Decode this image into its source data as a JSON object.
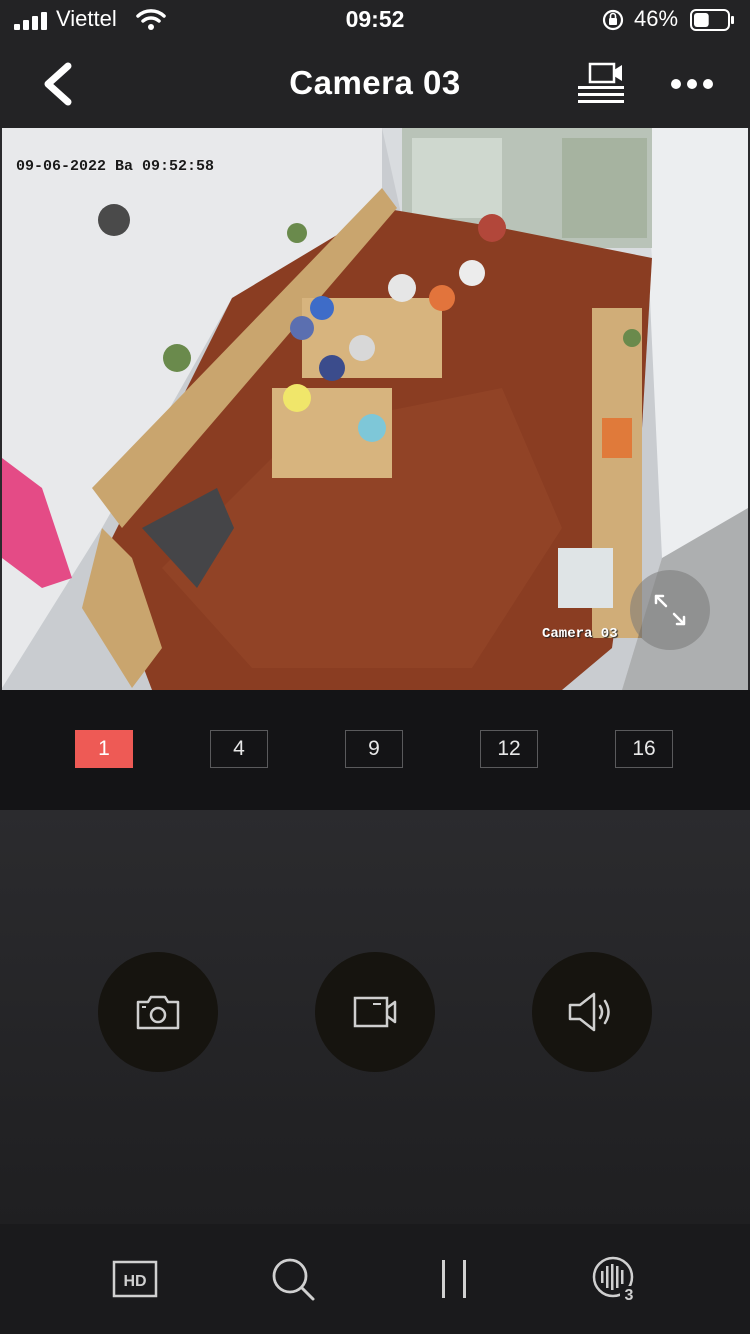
{
  "status_bar": {
    "carrier": "Viettel",
    "time": "09:52",
    "battery_percent": "46%",
    "battery_level": 0.46
  },
  "header": {
    "title": "Camera 03"
  },
  "video": {
    "osd_datetime": "09-06-2022 Ba  09:52:58",
    "osd_camera_label": "Camera 03"
  },
  "grid_options": [
    {
      "label": "1",
      "active": true
    },
    {
      "label": "4",
      "active": false
    },
    {
      "label": "9",
      "active": false
    },
    {
      "label": "12",
      "active": false
    },
    {
      "label": "16",
      "active": false
    }
  ],
  "controls": {
    "snapshot_icon": "camera-icon",
    "record_icon": "video-record-icon",
    "audio_icon": "speaker-icon"
  },
  "toolbar": {
    "quality_label": "HD",
    "channel_badge": "3"
  },
  "colors": {
    "accent": "#ee5a55",
    "background": "#2a2a2c",
    "header": "#232325"
  }
}
